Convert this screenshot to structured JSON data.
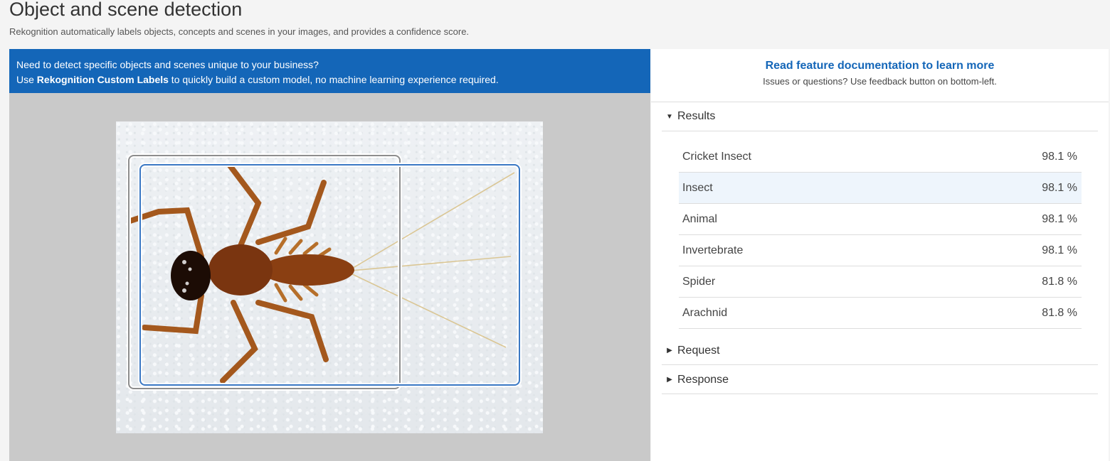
{
  "header": {
    "title": "Object and scene detection",
    "subtitle": "Rekognition automatically labels objects, concepts and scenes in your images, and provides a confidence score."
  },
  "banner": {
    "line1": "Need to detect specific objects and scenes unique to your business?",
    "line2_prefix": "Use ",
    "line2_bold": "Rekognition Custom Labels",
    "line2_suffix": " to quickly build a custom model, no machine learning experience required."
  },
  "doc": {
    "link": "Read feature documentation to learn more",
    "note": "Issues or questions? Use feedback button on bottom-left."
  },
  "sections": {
    "results": "Results",
    "request": "Request",
    "response": "Response"
  },
  "results": [
    {
      "label": "Cricket Insect",
      "confidence": "98.1 %"
    },
    {
      "label": "Insect",
      "confidence": "98.1 %"
    },
    {
      "label": "Animal",
      "confidence": "98.1 %"
    },
    {
      "label": "Invertebrate",
      "confidence": "98.1 %"
    },
    {
      "label": "Spider",
      "confidence": "81.8 %"
    },
    {
      "label": "Arachnid",
      "confidence": "81.8 %"
    }
  ],
  "colors": {
    "accent": "#1466b8",
    "selected_row": "#eef5fc",
    "panel_gray": "#c9c9c9"
  }
}
